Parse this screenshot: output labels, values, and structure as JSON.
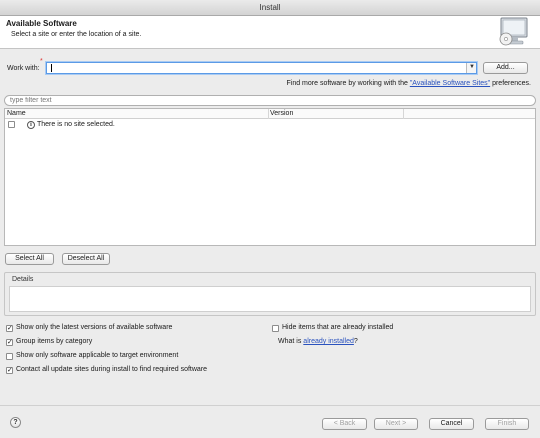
{
  "window": {
    "title": "Install"
  },
  "banner": {
    "heading": "Available Software",
    "subtitle": "Select a site or enter the location of a site.",
    "icon": "monitor-cd-icon"
  },
  "work_with": {
    "label": "Work with:",
    "required_marker": "*",
    "value": "",
    "add_label": "Add..."
  },
  "find_more": {
    "prefix": "Find more software by working with the ",
    "link": "\"Available Software Sites\"",
    "suffix": " preferences."
  },
  "filter": {
    "placeholder": "type filter text",
    "value": ""
  },
  "table": {
    "columns": [
      "Name",
      "Version"
    ],
    "rows": [
      {
        "text": "There is no site selected.",
        "icon": "info-icon",
        "checked": false
      }
    ]
  },
  "selection_buttons": {
    "select_all": "Select All",
    "deselect_all": "Deselect All"
  },
  "details": {
    "label": "Details",
    "content": ""
  },
  "options": {
    "latest_versions": {
      "label": "Show only the latest versions of available software",
      "checked": true
    },
    "group_by_category": {
      "label": "Group items by category",
      "checked": true
    },
    "target_env": {
      "label": "Show only software applicable to target environment",
      "checked": false
    },
    "contact_sites": {
      "label": "Contact all update sites during install to find required software",
      "checked": true
    },
    "hide_installed": {
      "label": "Hide items that are already installed",
      "checked": false
    },
    "what_is": {
      "prefix": "What is ",
      "link": "already installed",
      "suffix": "?"
    }
  },
  "footer": {
    "help": "?",
    "back": "< Back",
    "next": "Next >",
    "cancel": "Cancel",
    "finish": "Finish"
  }
}
